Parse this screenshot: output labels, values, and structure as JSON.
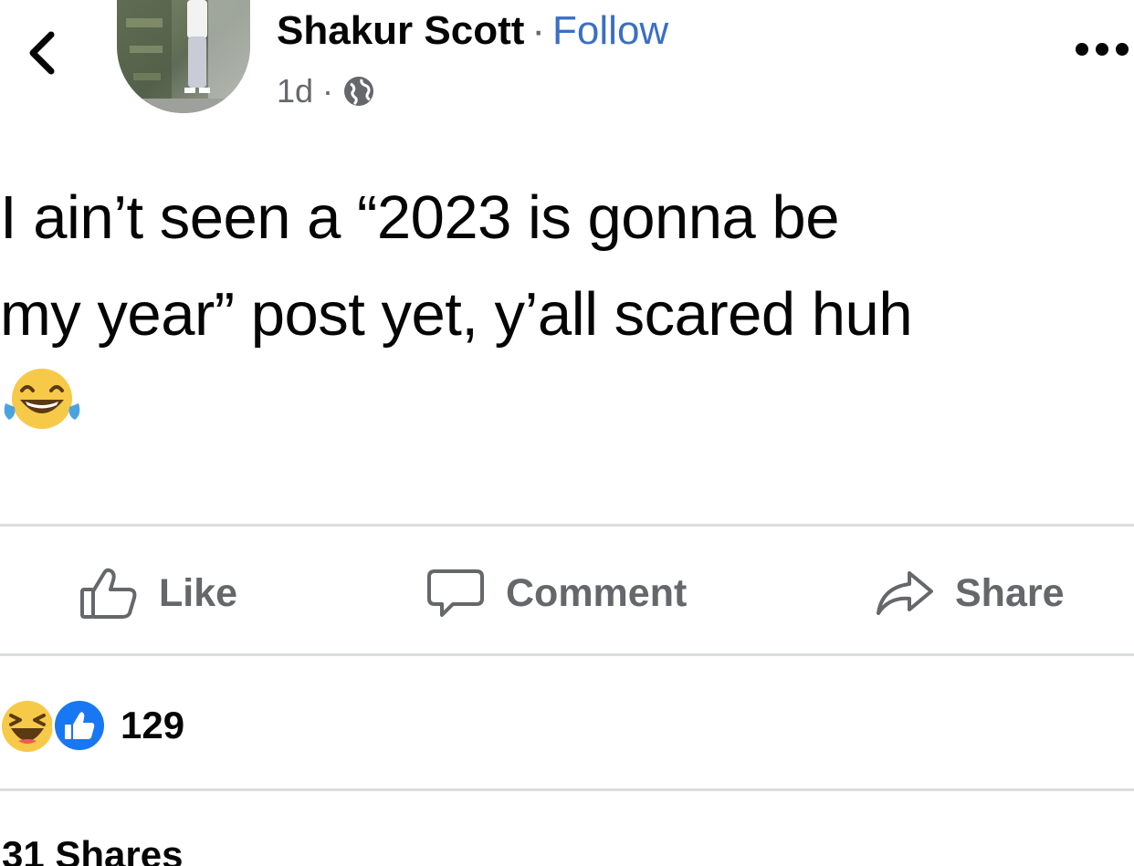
{
  "header": {
    "author_name": "Shakur Scott",
    "separator": "·",
    "follow_label": "Follow",
    "timestamp": "1d",
    "meta_separator": "·",
    "privacy_icon": "globe-icon",
    "back_icon": "chevron-left-icon",
    "more_icon": "more-horizontal-icon"
  },
  "post": {
    "text_line1": "I ain’t seen a “2023 is gonna be",
    "text_line2": "my year” post yet, y’all scared huh",
    "emoji": "face-with-tears-of-joy-emoji"
  },
  "actions": {
    "like_label": "Like",
    "comment_label": "Comment",
    "share_label": "Share"
  },
  "reactions": {
    "icons": [
      "haha-reaction-icon",
      "like-reaction-icon"
    ],
    "count": "129"
  },
  "footer": {
    "shares_label": "31 Shares"
  },
  "colors": {
    "text": "#050505",
    "secondary": "#65676b",
    "link": "#3b6fc4",
    "divider": "#dadde1",
    "like_blue": "#1877f2",
    "emoji_yellow": "#f7c948"
  }
}
